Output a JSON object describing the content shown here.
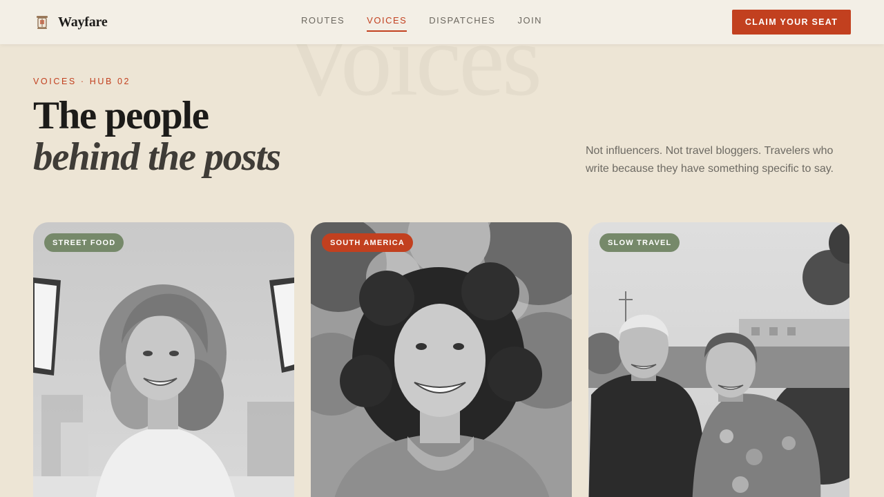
{
  "brand": {
    "name": "Wayfare",
    "logo_icon": "lantern-icon"
  },
  "nav": {
    "items": [
      {
        "label": "ROUTES",
        "active": false
      },
      {
        "label": "VOICES",
        "active": true
      },
      {
        "label": "DISPATCHES",
        "active": false
      },
      {
        "label": "JOIN",
        "active": false
      }
    ]
  },
  "cta": {
    "label": "CLAIM YOUR SEAT"
  },
  "hero": {
    "watermark": "Voices",
    "eyebrow": "VOICES · HUB 02",
    "headline_line1": "The people",
    "headline_line2": "behind the posts",
    "lede": "Not influencers. Not travel bloggers. Travelers who write because they have something specific to say."
  },
  "cards": [
    {
      "tag": "STREET FOOD",
      "tag_color": "#76896a",
      "photo": "portrait-woman-smiling"
    },
    {
      "tag": "SOUTH AMERICA",
      "tag_color": "#c2401f",
      "photo": "portrait-woman-curly-hair"
    },
    {
      "tag": "SLOW TRAVEL",
      "tag_color": "#76896a",
      "photo": "portrait-older-couple"
    }
  ],
  "colors": {
    "accent": "#c2401f",
    "sage": "#76896a",
    "background": "#ede5d5",
    "header": "#f3efe6"
  }
}
